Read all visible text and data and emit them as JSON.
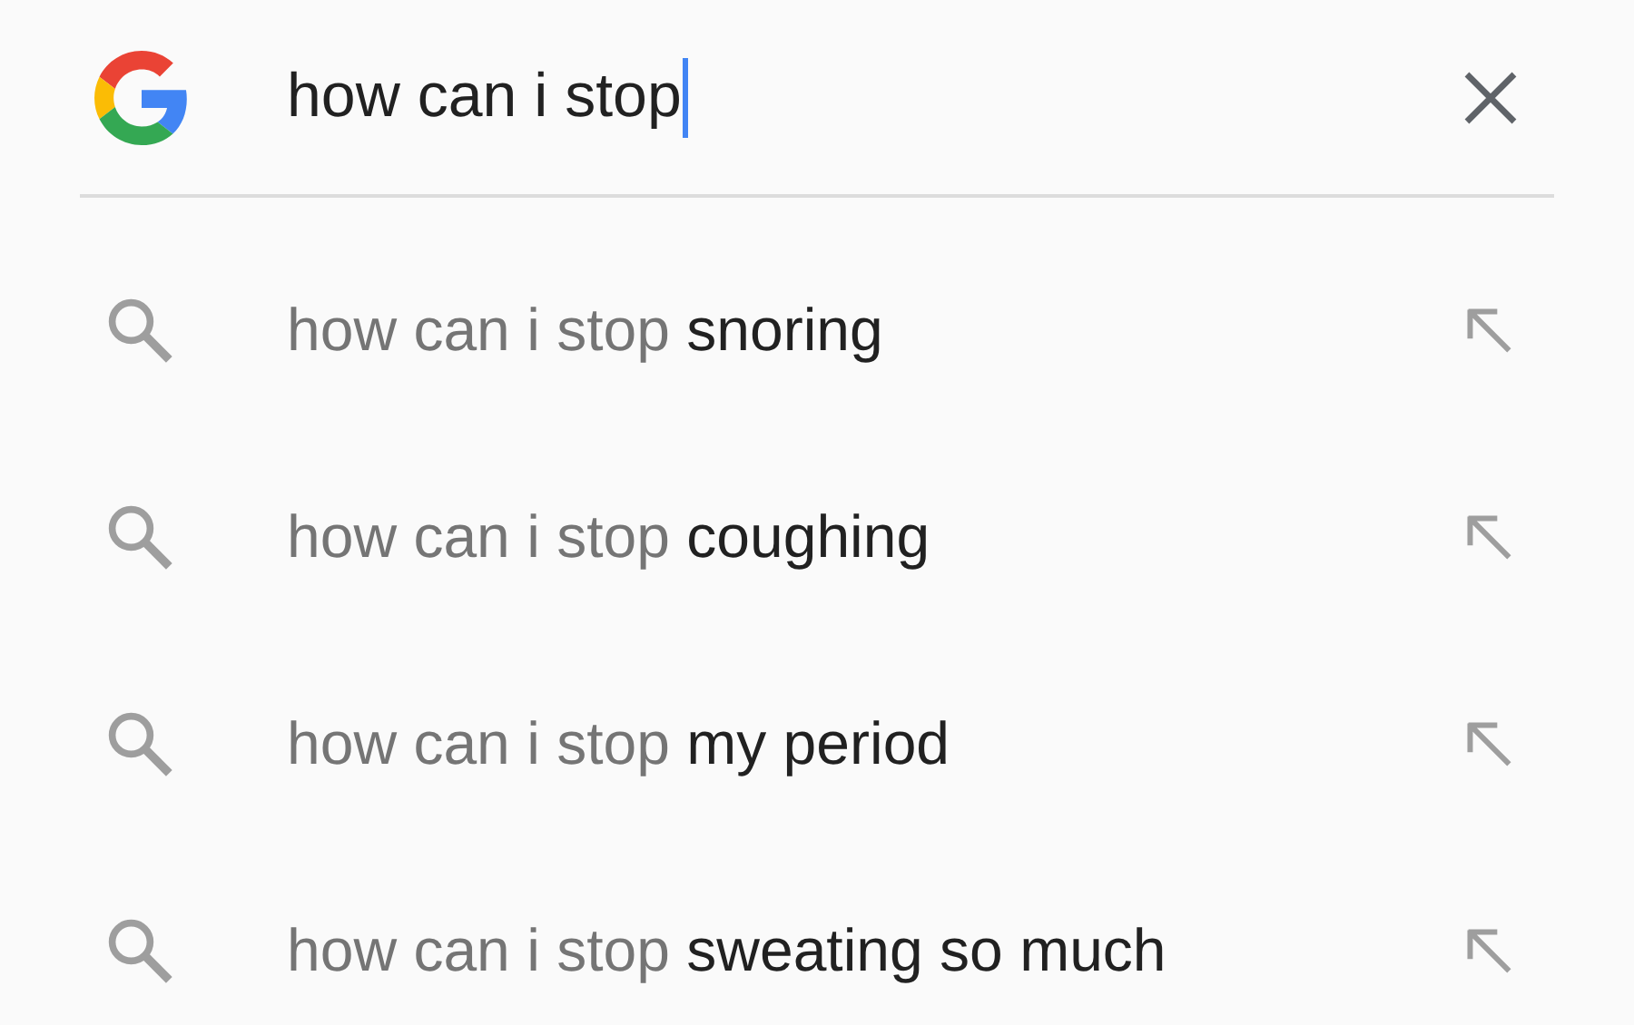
{
  "search": {
    "value": "how can i stop",
    "focused": true
  },
  "suggestions": [
    {
      "query": "how can i stop",
      "completion": "snoring"
    },
    {
      "query": "how can i stop",
      "completion": "coughing"
    },
    {
      "query": "how can i stop",
      "completion": "my period"
    },
    {
      "query": "how can i stop",
      "completion": "sweating so much"
    }
  ]
}
